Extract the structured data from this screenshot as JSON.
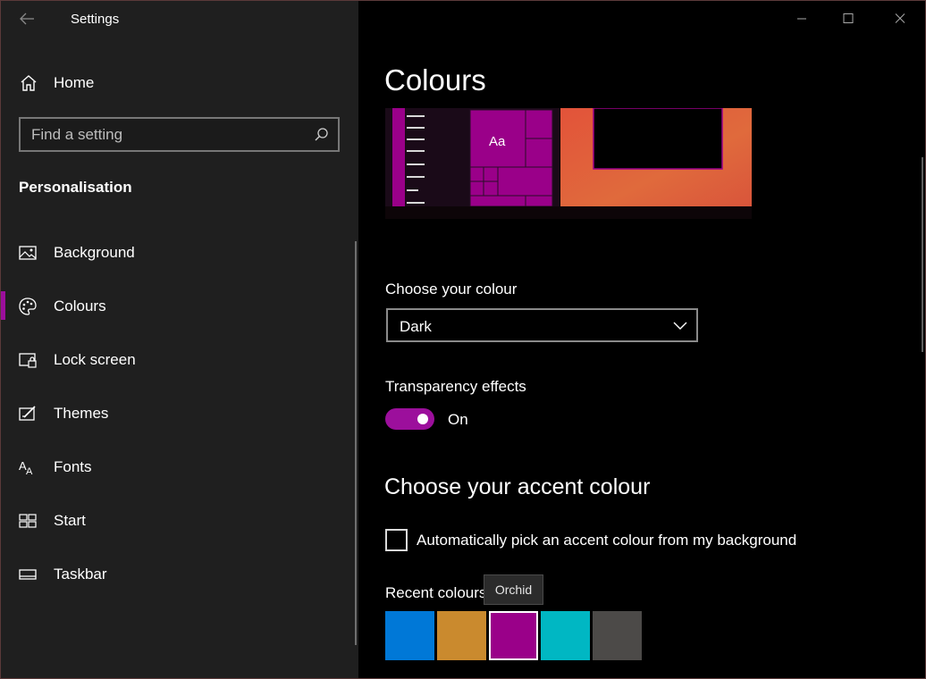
{
  "window": {
    "title": "Settings"
  },
  "sidebar": {
    "home_label": "Home",
    "search_placeholder": "Find a setting",
    "section_heading": "Personalisation",
    "items": [
      {
        "label": "Background",
        "icon": "image-icon",
        "selected": false
      },
      {
        "label": "Colours",
        "icon": "palette-icon",
        "selected": true
      },
      {
        "label": "Lock screen",
        "icon": "lock-screen-icon",
        "selected": false
      },
      {
        "label": "Themes",
        "icon": "themes-icon",
        "selected": false
      },
      {
        "label": "Fonts",
        "icon": "fonts-icon",
        "selected": false
      },
      {
        "label": "Start",
        "icon": "start-icon",
        "selected": false
      },
      {
        "label": "Taskbar",
        "icon": "taskbar-icon",
        "selected": false
      }
    ]
  },
  "main": {
    "page_title": "Colours",
    "preview": {
      "sample_text": "Aa"
    },
    "choose_colour": {
      "label": "Choose your colour",
      "selected": "Dark"
    },
    "transparency": {
      "label": "Transparency effects",
      "state": "On",
      "on": true
    },
    "accent": {
      "title": "Choose your accent colour",
      "auto_pick_label": "Automatically pick an accent colour from my background",
      "auto_pick_checked": false,
      "recent_label": "Recent colours",
      "tooltip": "Orchid",
      "recent_colours": [
        "#0078d7",
        "#ca8a2e",
        "#9a0089",
        "#00b7c3",
        "#4c4a48"
      ],
      "selected_index": 2
    }
  },
  "colors": {
    "accent": "#9a0089",
    "sidebar_bg": "#1f1f1f",
    "main_bg": "#000000"
  }
}
